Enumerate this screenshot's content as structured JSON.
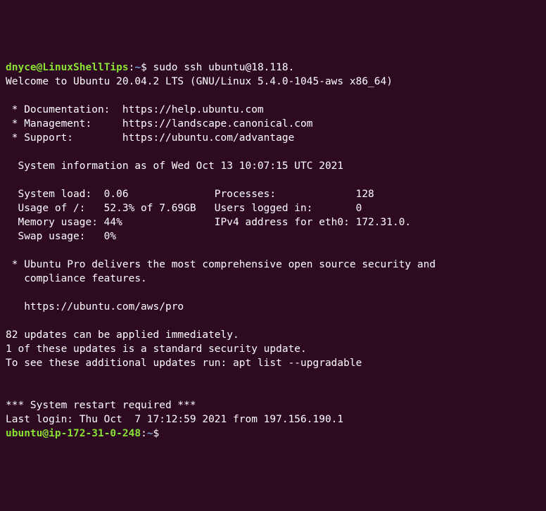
{
  "first_prompt": {
    "user": "dnyce",
    "at": "@",
    "host": "LinuxShellTips",
    "colon": ":",
    "path": "~",
    "dollar": "$ ",
    "cmd": "sudo ssh ubuntu@18.118."
  },
  "welcome": "Welcome to Ubuntu 20.04.2 LTS (GNU/Linux 5.4.0-1045-aws x86_64)",
  "links": {
    "doc": " * Documentation:  https://help.ubuntu.com",
    "mgmt": " * Management:     https://landscape.canonical.com",
    "support": " * Support:        https://ubuntu.com/advantage"
  },
  "sysinfo_header": "  System information as of Wed Oct 13 10:07:15 UTC 2021",
  "sysinfo": {
    "l1": "  System load:  0.06              Processes:             128",
    "l2": "  Usage of /:   52.3% of 7.69GB   Users logged in:       0",
    "l3": "  Memory usage: 44%               IPv4 address for eth0: 172.31.0.",
    "l4": "  Swap usage:   0%"
  },
  "pro": {
    "l1": " * Ubuntu Pro delivers the most comprehensive open source security and",
    "l2": "   compliance features.",
    "l3": "   https://ubuntu.com/aws/pro"
  },
  "updates": {
    "l1": "82 updates can be applied immediately.",
    "l2": "1 of these updates is a standard security update.",
    "l3": "To see these additional updates run: apt list --upgradable"
  },
  "restart": "*** System restart required ***",
  "last_login": "Last login: Thu Oct  7 17:12:59 2021 from 197.156.190.1",
  "second_prompt": {
    "user": "ubuntu",
    "at": "@",
    "host": "ip-172-31-0-248",
    "colon": ":",
    "path": "~",
    "dollar": "$ "
  }
}
